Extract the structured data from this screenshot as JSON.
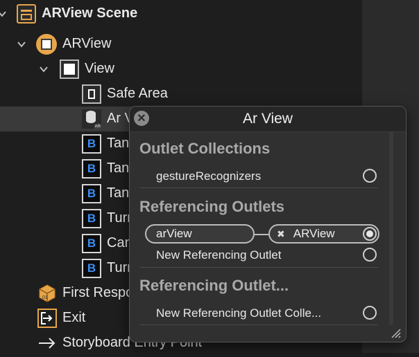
{
  "outline": {
    "scene": {
      "label": "ARView Scene"
    },
    "view_controller": {
      "label": "ARView"
    },
    "view": {
      "label": "View"
    },
    "safe_area": {
      "label": "Safe Area"
    },
    "ar_view": {
      "label": "Ar View"
    },
    "buttons": [
      {
        "label": "TankForward"
      },
      {
        "label": "TankForward"
      },
      {
        "label": "TankLeft"
      },
      {
        "label": "TurretRight"
      },
      {
        "label": "CannonFire"
      },
      {
        "label": "TurretLeft"
      }
    ],
    "first_responder": {
      "label": "First Responder"
    },
    "exit": {
      "label": "Exit"
    },
    "entry_point": {
      "label": "Storyboard Entry Point"
    }
  },
  "popup": {
    "title": "Ar View",
    "outlet_collections": {
      "heading": "Outlet Collections",
      "item": "gestureRecognizers"
    },
    "referencing_outlets": {
      "heading": "Referencing Outlets",
      "connection_source": "arView",
      "connection_target": "ARView",
      "new_item": "New Referencing Outlet"
    },
    "referencing_outlet_collections": {
      "heading": "Referencing Outlet...",
      "new_item": "New Referencing Outlet Colle..."
    }
  },
  "colors": {
    "accent_orange": "#e7a64a",
    "button_blue": "#3b8df2"
  }
}
